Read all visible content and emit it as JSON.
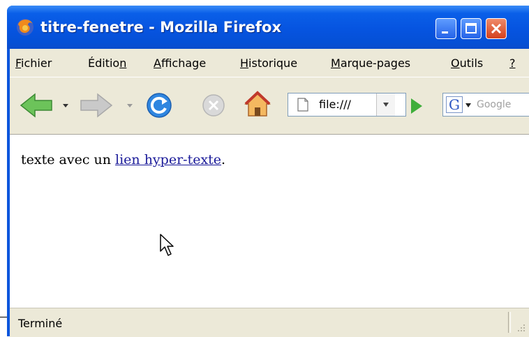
{
  "window": {
    "title": "titre-fenetre - Mozilla Firefox",
    "controls": [
      "minimize",
      "maximize",
      "close"
    ]
  },
  "menubar": {
    "items": [
      {
        "pre": "",
        "u": "F",
        "post": "ichier"
      },
      {
        "pre": "Éditio",
        "u": "n",
        "post": ""
      },
      {
        "pre": "",
        "u": "A",
        "post": "ffichage"
      },
      {
        "pre": "",
        "u": "H",
        "post": "istorique"
      },
      {
        "pre": "",
        "u": "M",
        "post": "arque-pages"
      },
      {
        "pre": "",
        "u": "O",
        "post": "utils"
      },
      {
        "pre": "",
        "u": "?",
        "post": ""
      }
    ]
  },
  "toolbar": {
    "buttons": [
      "back",
      "forward",
      "reload",
      "stop",
      "home"
    ],
    "url": "file:///",
    "search_placeholder": "Google",
    "search_engine_letter": "G"
  },
  "content": {
    "text_before": "texte avec un ",
    "link_text": "lien hyper-texte",
    "text_after": "."
  },
  "status": {
    "text": "Terminé"
  },
  "colors": {
    "titlebar": "#0654e0",
    "chrome": "#ece9d8",
    "link": "#1a1a99"
  }
}
